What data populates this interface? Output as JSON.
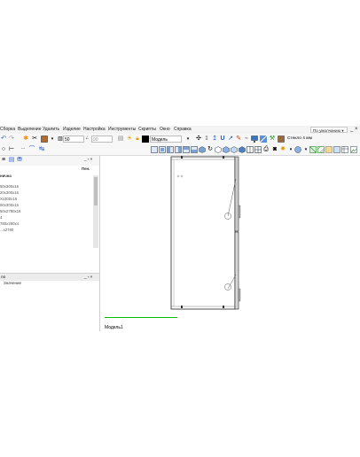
{
  "menu": {
    "items": [
      "Сборка",
      "Выделение",
      "Удалить",
      "Изделие",
      "Настройка",
      "Инструменты",
      "Скрипты",
      "Окно",
      "Справка"
    ],
    "preset": "По умолчанию",
    "minimize": "_",
    "close": "×"
  },
  "toolbar1": {
    "step_value": "50",
    "angle_value": "90",
    "layer_label": "Модель",
    "layer_color": "#000000"
  },
  "toolbar2": {
    "material_label": "Стекло 4 мм"
  },
  "object_panel": {
    "column_header": "Пен.",
    "root_label": "нична",
    "rows": [
      "50x300x16",
      "20x300x16",
      "Хx300x16",
      "00x300x16",
      "50x2780x16",
      "4",
      "780x290x4",
      "...x2780"
    ]
  },
  "props_panel": {
    "title": "ло",
    "column_header": "Значение"
  },
  "viewport": {
    "tab_label": "Модель1",
    "front_color": "#d8d8d8",
    "handle_color": "#aaaaaa"
  },
  "colors": {
    "accent_green": "#00c000",
    "toolbar_bg": "#f7f7f7"
  }
}
